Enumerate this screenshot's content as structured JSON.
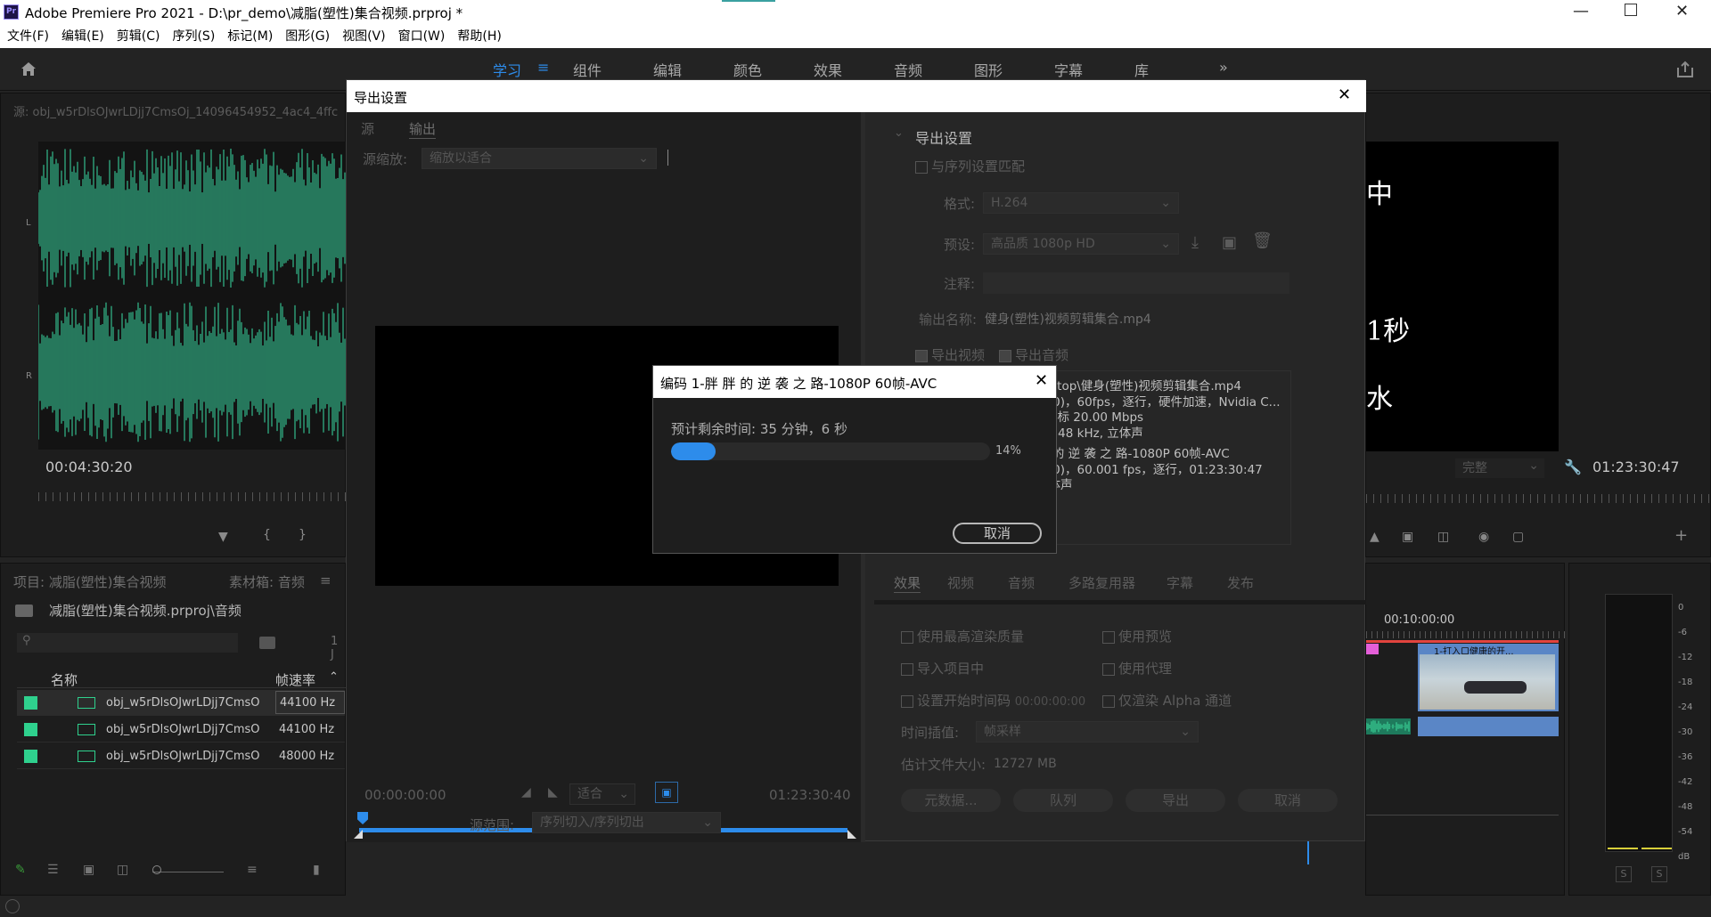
{
  "app": {
    "title": "Adobe Premiere Pro 2021 - D:\\pr_demo\\减脂(塑性)集合视频.prproj *",
    "logo_text": "Pr"
  },
  "menu": [
    "文件(F)",
    "编辑(E)",
    "剪辑(C)",
    "序列(S)",
    "标记(M)",
    "图形(G)",
    "视图(V)",
    "窗口(W)",
    "帮助(H)"
  ],
  "workspaces": [
    "学习",
    "组件",
    "编辑",
    "颜色",
    "效果",
    "音频",
    "图形",
    "字幕",
    "库"
  ],
  "workspace_active_index": 0,
  "source_monitor": {
    "title": "源: obj_w5rDlsOJwrLDjj7CmsOj_14096454952_4ac4_4ffc",
    "channel_L": "L",
    "channel_R": "R",
    "timecode": "00:04:30:20"
  },
  "project_panel": {
    "tab_project": "项目: 减脂(塑性)集合视频",
    "tab_bin": "素材箱: 音频",
    "path": "减脂(塑性)集合视频.prproj\\音频",
    "count": "1 J",
    "col_name": "名称",
    "col_rate": "帧速率",
    "rows": [
      {
        "name": "obj_w5rDlsOJwrLDjj7CmsO",
        "rate": "44100 Hz"
      },
      {
        "name": "obj_w5rDlsOJwrLDjj7CmsO",
        "rate": "44100 Hz"
      },
      {
        "name": "obj_w5rDlsOJwrLDjj7CmsO",
        "rate": "48000 Hz"
      }
    ]
  },
  "program_monitor": {
    "overlay_chars": [
      "中",
      "1秒",
      "水"
    ],
    "quality": "完整",
    "timecode": "01:23:30:47"
  },
  "timeline": {
    "ruler_time": "00:10:00:00",
    "clip_label": "1-打入口健康的开..."
  },
  "audio_meter": {
    "labels": [
      "0",
      "-6",
      "-12",
      "-18",
      "-24",
      "-30",
      "-36",
      "-42",
      "-48",
      "-54",
      "dB"
    ],
    "solo_left": "S",
    "solo_right": "S"
  },
  "export_dialog": {
    "title": "导出设置",
    "tabs": [
      "源",
      "输出"
    ],
    "source_scaling_label": "源缩放:",
    "source_scaling_value": "缩放以适合",
    "start_timecode": "00:00:00:00",
    "fit_value": "适合",
    "end_timecode": "01:23:30:40",
    "source_range_label": "源范围:",
    "source_range_value": "序列切入/序列切出",
    "settings": {
      "section": "导出设置",
      "match_sequence": "与序列设置匹配",
      "format_label": "格式:",
      "format_value": "H.264",
      "preset_label": "预设:",
      "preset_value": "高品质 1080p HD",
      "comments_label": "注释:",
      "output_name_label": "输出名称:",
      "output_name_value": "健身(塑性)视频剪辑集合.mp4",
      "export_video": "导出视频",
      "export_audio": "导出音频",
      "summary_lines": [
        "esktop\\健身(塑性)视频剪辑集合.mp4",
        "(1.0)，60fps，逐行，硬件加速，Nvidia C...",
        "目标 20.00 Mbps",
        "ps, 48 kHz, 立体声",
        "胖 的 逆 袭 之 路-1080P 60帧-AVC",
        "(1.0)，60.001 fps，逐行，01:23:30:47",
        "立体声"
      ]
    },
    "lower_tabs": [
      "效果",
      "视频",
      "音频",
      "多路复用器",
      "字幕",
      "发布"
    ],
    "options": {
      "max_render_quality": "使用最高渲染质量",
      "use_previews": "使用预览",
      "import_into_project": "导入项目中",
      "use_proxies": "使用代理",
      "set_start_timecode": "设置开始时间码",
      "start_timecode_value": "00:00:00:00",
      "render_alpha_only": "仅渲染 Alpha 通道",
      "time_interpolation_label": "时间插值:",
      "time_interpolation_value": "帧采样",
      "file_size_label": "估计文件大小:",
      "file_size_value": "12727 MB"
    },
    "buttons": {
      "metadata": "元数据...",
      "queue": "队列",
      "export": "导出",
      "cancel": "取消"
    }
  },
  "progress_dialog": {
    "title": "编码 1-胖 胖 的 逆 袭 之 路-1080P 60帧-AVC",
    "remaining": "预计剩余时间: 35 分钟，6 秒",
    "percent_text": "14%",
    "progress": 0.14,
    "cancel": "取消"
  },
  "colors": {
    "accent_blue": "#2d8ceb",
    "waveform_green": "#2fa37b",
    "clip_blue": "#5a86c6"
  }
}
